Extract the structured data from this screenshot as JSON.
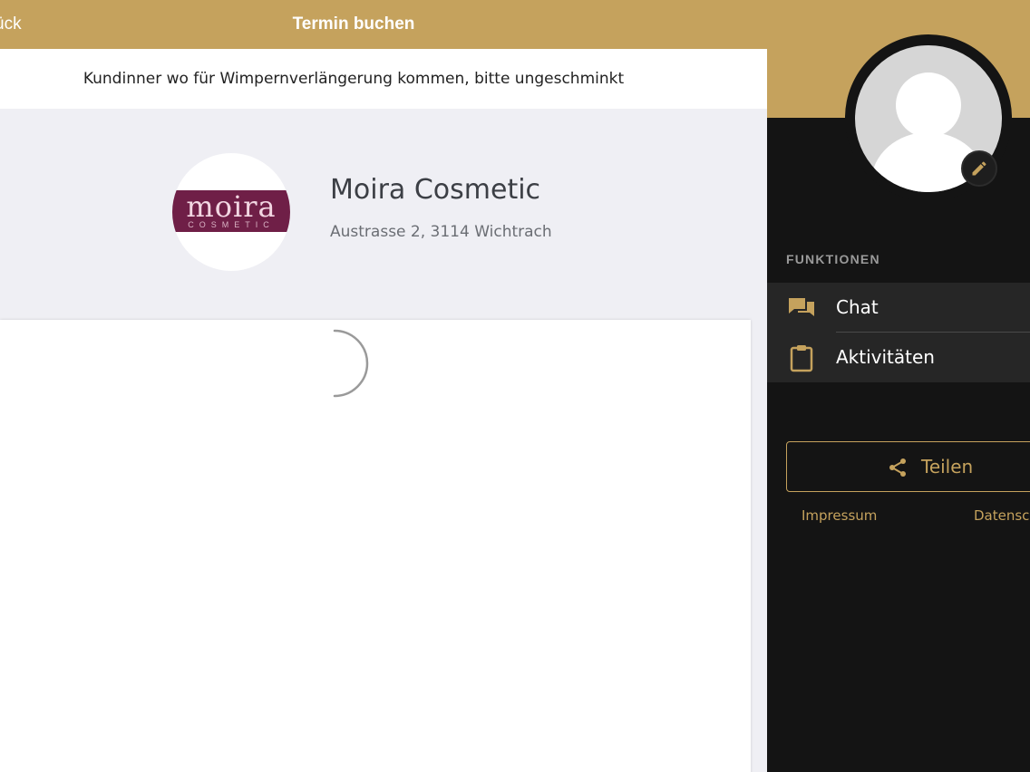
{
  "header": {
    "back_label": "ück",
    "title": "Termin buchen"
  },
  "notice": {
    "text": "Kundinner wo für Wimpernverlängerung kommen, bitte ungeschminkt"
  },
  "salon": {
    "logo_word": "moira",
    "logo_sub": "COSMETIC",
    "name": "Moira Cosmetic",
    "address": "Austrasse 2, 3114 Wichtrach"
  },
  "booking": {
    "loading_icon": "spinner-icon"
  },
  "sidebar": {
    "section_label": "FUNKTIONEN",
    "items": [
      {
        "label": "Chat",
        "icon": "chat-icon"
      },
      {
        "label": "Aktivitäten",
        "icon": "clipboard-icon"
      }
    ],
    "share_label": "Teilen",
    "footer": {
      "impressum": "Impressum",
      "datenschutz": "Datensch"
    }
  },
  "colors": {
    "accent_gold": "#c5a25d",
    "sidebar_bg": "#141414",
    "menu_item_bg": "#262626",
    "logo_purple": "#6f1f47",
    "page_bg": "#efeff4"
  }
}
